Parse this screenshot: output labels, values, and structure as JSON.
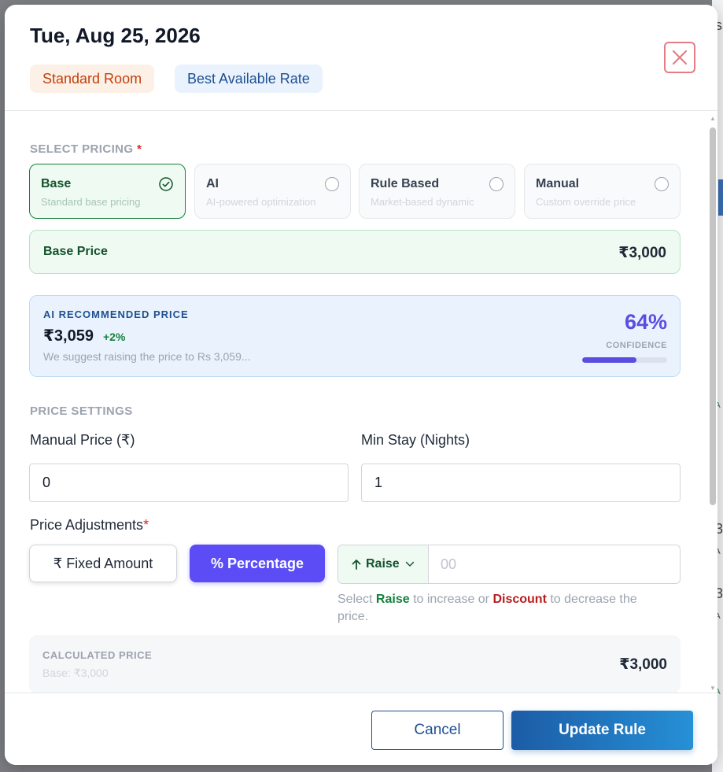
{
  "background_fragments": [
    "s",
    "A",
    "3,",
    "A",
    "3,",
    "A",
    "A"
  ],
  "header": {
    "date": "Tue, Aug 25, 2026",
    "room_badge": "Standard Room",
    "rate_badge": "Best Available Rate",
    "close_icon": "close-x-icon"
  },
  "select_pricing": {
    "label": "SELECT PRICING",
    "required_mark": "*",
    "options": [
      {
        "title": "Base",
        "subtitle": "Standard base pricing",
        "selected": true
      },
      {
        "title": "AI",
        "subtitle": "AI-powered optimization",
        "selected": false
      },
      {
        "title": "Rule Based",
        "subtitle": "Market-based dynamic",
        "selected": false
      },
      {
        "title": "Manual",
        "subtitle": "Custom override price",
        "selected": false
      }
    ]
  },
  "base_price": {
    "label": "Base Price",
    "value": "₹3,000"
  },
  "ai_recommendation": {
    "title": "AI RECOMMENDED PRICE",
    "price": "₹3,059",
    "change": "+2%",
    "message": "We suggest raising the price to Rs 3,059...",
    "confidence_value": "64%",
    "confidence_label": "CONFIDENCE",
    "confidence_fraction": 0.64
  },
  "price_settings": {
    "label": "PRICE SETTINGS",
    "manual_price_label": "Manual Price (₹)",
    "manual_price_value": "0",
    "min_stay_label": "Min Stay (Nights)",
    "min_stay_value": "1"
  },
  "adjustments": {
    "label": "Price Adjustments",
    "required_mark": "*",
    "fixed_label": "₹ Fixed Amount",
    "percentage_label": "% Percentage",
    "direction_label": "Raise",
    "amount_placeholder": "00",
    "hint_prefix": "Select ",
    "hint_raise": "Raise",
    "hint_middle": " to increase or ",
    "hint_discount": "Discount",
    "hint_suffix": " to decrease the price."
  },
  "calculated": {
    "title": "CALCULATED PRICE",
    "base_note": "Base: ₹3,000",
    "value": "₹3,000"
  },
  "footer": {
    "cancel_label": "Cancel",
    "update_label": "Update Rule"
  },
  "colors": {
    "accent_purple": "#5b4cf5",
    "success_green": "#15803d",
    "danger_red": "#b91c1c",
    "primary_blue": "#1e4f91"
  }
}
